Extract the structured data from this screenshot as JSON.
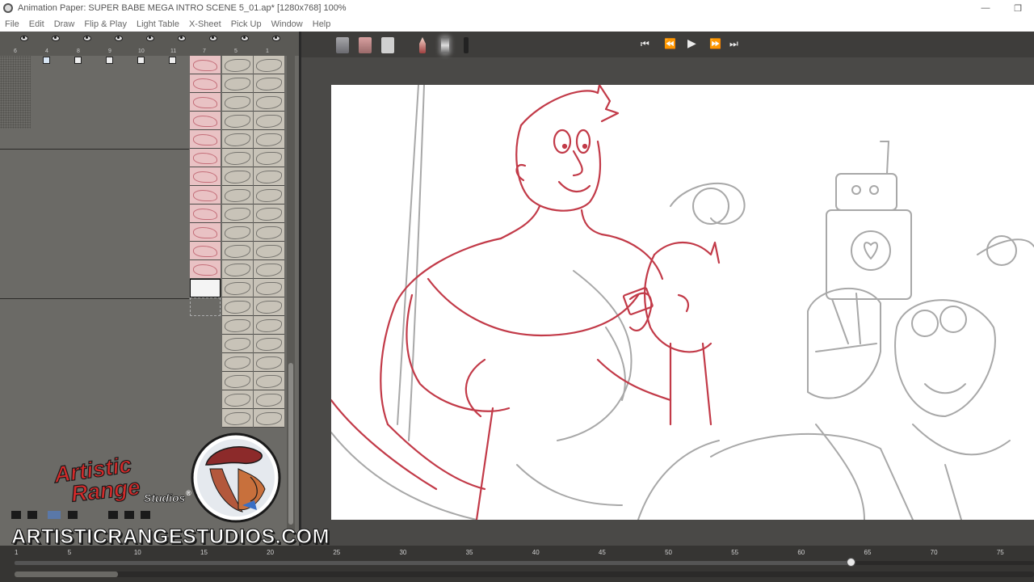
{
  "window": {
    "title": "Animation Paper: SUPER BABE MEGA INTRO SCENE 5_01.ap* [1280x768] 100%",
    "minimize_glyph": "—",
    "restore_glyph": "❐"
  },
  "menu": [
    "File",
    "Edit",
    "Draw",
    "Flip & Play",
    "Light Table",
    "X-Sheet",
    "Pick Up",
    "Window",
    "Help"
  ],
  "xsheet": {
    "column_numbers": [
      "6",
      "4",
      "8",
      "9",
      "10",
      "11",
      "7",
      "5",
      "1"
    ],
    "pink_frame_count": 12,
    "gray_frame_count": 20
  },
  "toolbar": {
    "tools": [
      "brush-tool",
      "eraser-tool",
      "rectangle-tool",
      "pencil-tool",
      "marker-tool",
      "pen-tool"
    ],
    "active_tool": "marker-tool"
  },
  "transport": {
    "first_frame": "⏮",
    "prev_frame": "⏪",
    "play": "▶",
    "next_frame": "⏩",
    "last_frame": "⏭"
  },
  "watermark": {
    "logo_line1": "Artistic",
    "logo_line2": "Range",
    "logo_line3": "Studios",
    "registered": "®",
    "url": "ARTISTICRANGESTUDIOS.COM"
  },
  "timeline": {
    "frame_labels": [
      "1",
      "5",
      "10",
      "15",
      "20",
      "25",
      "30",
      "35",
      "40",
      "45",
      "50",
      "55",
      "60",
      "65",
      "70",
      "75"
    ],
    "current_frame": 64
  },
  "colors": {
    "accent_red": "#c0303f",
    "sketch_gray": "#9a9a9a",
    "panel": "#6b6a66"
  }
}
